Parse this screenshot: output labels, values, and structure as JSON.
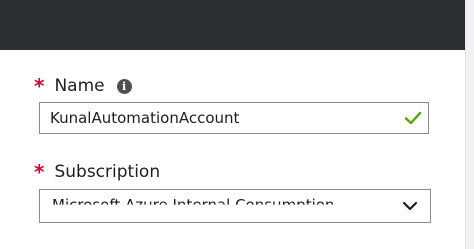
{
  "name_field": {
    "label": "Name",
    "required_marker": "*",
    "info_glyph": "i",
    "value": "KunalAutomationAccount",
    "valid": true,
    "valid_icon": "checkmark-icon",
    "valid_color": "#57a300"
  },
  "subscription_field": {
    "label": "Subscription",
    "required_marker": "*",
    "selected_value": "Microsoft Azure Internal Consumption",
    "dropdown_icon": "chevron-down-icon"
  },
  "colors": {
    "header": "#2b2f33",
    "required": "#e0002b"
  }
}
